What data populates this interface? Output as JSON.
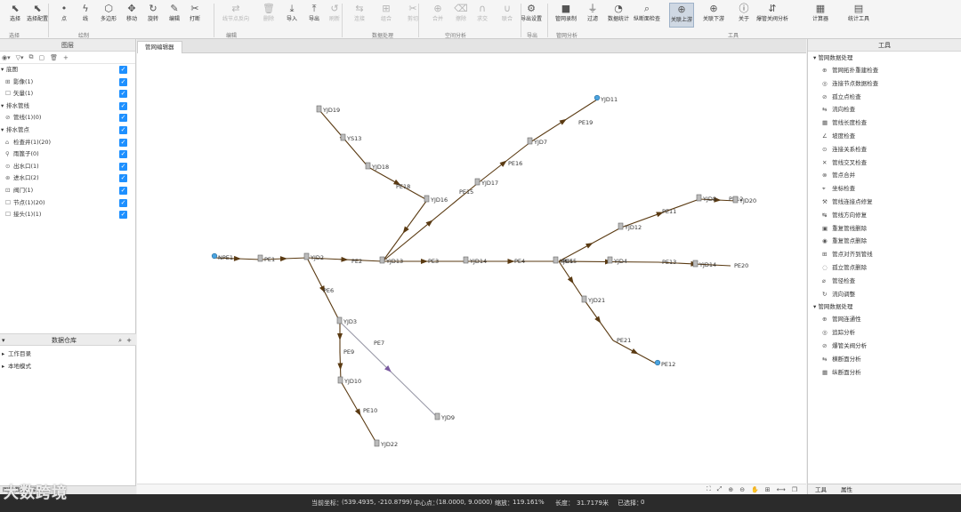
{
  "toolbar": {
    "buttons": [
      {
        "label": "选择",
        "icon": "arrow-icon"
      },
      {
        "label": "选择配置",
        "icon": "arrow-config-icon"
      },
      {
        "label": "点",
        "icon": "point-icon"
      },
      {
        "label": "线",
        "icon": "line-icon"
      },
      {
        "label": "多边形",
        "icon": "polygon-icon"
      },
      {
        "label": "移动",
        "icon": "move-icon"
      },
      {
        "label": "旋转",
        "icon": "rotate-icon"
      },
      {
        "label": "编辑",
        "icon": "edit-icon"
      },
      {
        "label": "打断",
        "icon": "break-icon"
      },
      {
        "label": "线节点反向",
        "icon": "reverse-icon"
      },
      {
        "label": "删除",
        "icon": "delete-icon"
      },
      {
        "label": "导入",
        "icon": "import-icon"
      },
      {
        "label": "导出",
        "icon": "export-icon"
      },
      {
        "label": "刷新",
        "icon": "refresh-icon"
      },
      {
        "label": "连接",
        "icon": "connect-icon"
      },
      {
        "label": "组合",
        "icon": "combine-icon"
      },
      {
        "label": "剪切",
        "icon": "cut-icon"
      },
      {
        "label": "合并",
        "icon": "merge-icon"
      },
      {
        "label": "擦除",
        "icon": "erase-icon"
      },
      {
        "label": "求交",
        "icon": "intersect-icon"
      },
      {
        "label": "联合",
        "icon": "union-icon"
      },
      {
        "label": "导出设置",
        "icon": "settings-icon"
      },
      {
        "label": "管网录制",
        "icon": "camera-icon"
      },
      {
        "label": "过滤",
        "icon": "filter-icon"
      },
      {
        "label": "数据统计",
        "icon": "chart-icon"
      },
      {
        "label": "纵断面检查",
        "icon": "magnifier-icon"
      },
      {
        "label": "关联上游",
        "icon": "upstream-icon"
      },
      {
        "label": "关联下游",
        "icon": "downstream-icon"
      },
      {
        "label": "关于",
        "icon": "info-icon"
      },
      {
        "label": "爆管关阀分析",
        "icon": "valve-icon"
      },
      {
        "label": "计算器",
        "icon": "calculator-icon"
      },
      {
        "label": "统计工具",
        "icon": "stats-icon"
      }
    ],
    "groups": [
      "选择",
      "绘制",
      "编辑",
      "数据处理",
      "空间分析",
      "导出",
      "管网分析",
      "工具"
    ]
  },
  "layers_panel": {
    "title": "图层",
    "groups": [
      {
        "label": "底图",
        "expanded": true,
        "items": [
          "影像(1)",
          "矢量(1)"
        ]
      },
      {
        "label": "排水管线",
        "expanded": true,
        "items": [
          "管线(1)(0)"
        ]
      },
      {
        "label": "排水管点",
        "expanded": true,
        "items": [
          "检查井(1)(20)",
          "雨篦子(0)",
          "出水口(1)",
          "进水口(2)",
          "阀门(1)",
          "节点(1)(20)",
          "接头(1)(1)"
        ]
      }
    ]
  },
  "workspace_panel": {
    "title": "数据仓库",
    "items": [
      "工作目录",
      "本地模式"
    ]
  },
  "canvas": {
    "tab": "管网编辑器",
    "status_icons": [
      "fit-icon",
      "full-icon",
      "zoom-in-icon",
      "zoom-out-icon",
      "pan-icon",
      "grid-icon",
      "measure-icon",
      "layer-icon"
    ]
  },
  "network": {
    "nodes": [
      {
        "label": "YJD19",
        "type": "well"
      },
      {
        "label": "YS13",
        "type": "well"
      },
      {
        "label": "YJD18",
        "type": "well"
      },
      {
        "label": "PE18",
        "type": "label"
      },
      {
        "label": "YJD16",
        "type": "well"
      },
      {
        "label": "PE15",
        "type": "label"
      },
      {
        "label": "YJD17",
        "type": "well"
      },
      {
        "label": "PE16",
        "type": "label"
      },
      {
        "label": "YJD7",
        "type": "well"
      },
      {
        "label": "PE19",
        "type": "label"
      },
      {
        "label": "YJD11",
        "type": "end"
      },
      {
        "label": "NPE1",
        "type": "end"
      },
      {
        "label": "PE1",
        "type": "well"
      },
      {
        "label": "YJD2",
        "type": "well"
      },
      {
        "label": "PE2",
        "type": "label"
      },
      {
        "label": "YJD13",
        "type": "well"
      },
      {
        "label": "PE3",
        "type": "label"
      },
      {
        "label": "YJD14",
        "type": "well"
      },
      {
        "label": "PE4",
        "type": "label"
      },
      {
        "label": "YJD15",
        "type": "well"
      },
      {
        "label": "PE6",
        "type": "label"
      },
      {
        "label": "YJD3",
        "type": "well"
      },
      {
        "label": "PE7",
        "type": "label"
      },
      {
        "label": "PE9",
        "type": "label"
      },
      {
        "label": "YJD10",
        "type": "well"
      },
      {
        "label": "PE10",
        "type": "label"
      },
      {
        "label": "YJD22",
        "type": "well"
      },
      {
        "label": "YJD9",
        "type": "well"
      },
      {
        "label": "YJD12",
        "type": "well"
      },
      {
        "label": "PE11",
        "type": "label"
      },
      {
        "label": "YJD8",
        "type": "well"
      },
      {
        "label": "PE12",
        "type": "label"
      },
      {
        "label": "YJD20",
        "type": "well"
      },
      {
        "label": "PE5",
        "type": "label"
      },
      {
        "label": "YJD4",
        "type": "well"
      },
      {
        "label": "PE13",
        "type": "label"
      },
      {
        "label": "YJD14",
        "type": "well"
      },
      {
        "label": "PE20",
        "type": "label"
      },
      {
        "label": "YJD21",
        "type": "well"
      },
      {
        "label": "PE21",
        "type": "label"
      },
      {
        "label": "PE12",
        "type": "end"
      }
    ]
  },
  "tools_panel": {
    "title": "工具",
    "groups": [
      {
        "label": "管网数据处理",
        "items": [
          "管网拓扑重建检查",
          "连接节点数据检查",
          "孤立点检查",
          "流向检查",
          "管线长度检查",
          "坡度检查",
          "连接关系检查",
          "管线交叉检查",
          "管点合并",
          "坐标检查",
          "管线连接点修复",
          "管线方向修复",
          "重复管线删除",
          "重复管点删除",
          "管点对齐到管线",
          "孤立管点删除",
          "管径检查",
          "流向调整"
        ]
      },
      {
        "label": "管网数据处理",
        "items": [
          "管网连通性",
          "追踪分析",
          "爆管关阀分析",
          "横断面分析",
          "纵断面分析"
        ]
      }
    ]
  },
  "right_tabs": [
    "工具",
    "属性"
  ],
  "statusbar": {
    "coord_label": "当前坐标：",
    "coord_value": "(539.4935, -210.8799)",
    "center_label": "中心点：",
    "center_value": "(18.0000, 9.0000)",
    "scale_label": "缩放：",
    "scale_value": "119.161%",
    "length_label": "长度：",
    "length_value": "31.7179米",
    "selected_label": "已选择：",
    "selected_value": "0"
  },
  "watermark": "大数跨境",
  "left_bottom_tabs": "图层   数据仓库"
}
